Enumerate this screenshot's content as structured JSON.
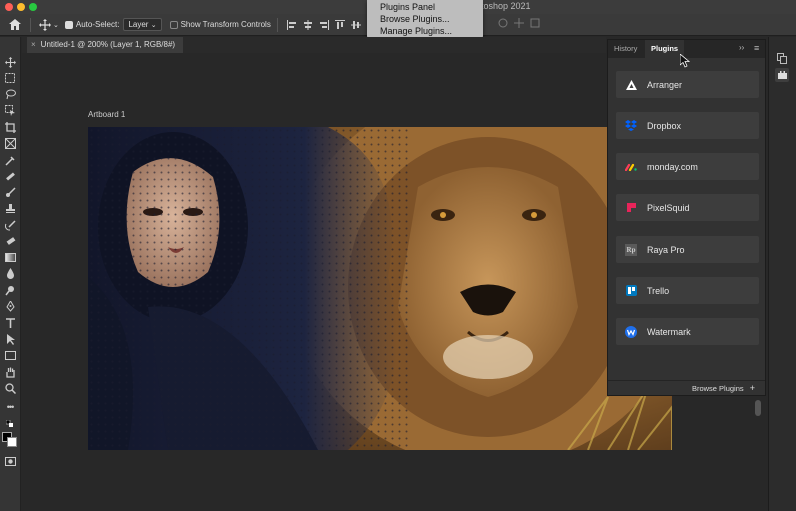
{
  "app": {
    "title": "otoshop 2021"
  },
  "options_bar": {
    "auto_select_label": "Auto-Select:",
    "auto_select_value": "Layer",
    "transform_controls_label": "Show Transform Controls"
  },
  "plugins_menu": {
    "items": [
      "Plugins Panel",
      "Browse Plugins...",
      "Manage Plugins..."
    ]
  },
  "document": {
    "tab_label": "Untitled-1 @ 200% (Layer 1, RGB/8#)",
    "artboard_label": "Artboard 1"
  },
  "panel": {
    "tabs": [
      "History",
      "Plugins"
    ],
    "active_tab": "Plugins",
    "plugins": [
      {
        "name": "Arranger",
        "icon": "arranger-icon",
        "color": "#ffffff"
      },
      {
        "name": "Dropbox",
        "icon": "dropbox-icon",
        "color": "#0061ff"
      },
      {
        "name": "monday.com",
        "icon": "monday-icon",
        "color": "#ff3d57"
      },
      {
        "name": "PixelSquid",
        "icon": "pixelsquid-icon",
        "color": "#e8245a"
      },
      {
        "name": "Raya Pro",
        "icon": "raya-pro-icon",
        "color": "#777777"
      },
      {
        "name": "Trello",
        "icon": "trello-icon",
        "color": "#0079bf"
      },
      {
        "name": "Watermark",
        "icon": "watermark-icon",
        "color": "#1f6feb"
      }
    ],
    "footer_label": "Browse Plugins"
  }
}
